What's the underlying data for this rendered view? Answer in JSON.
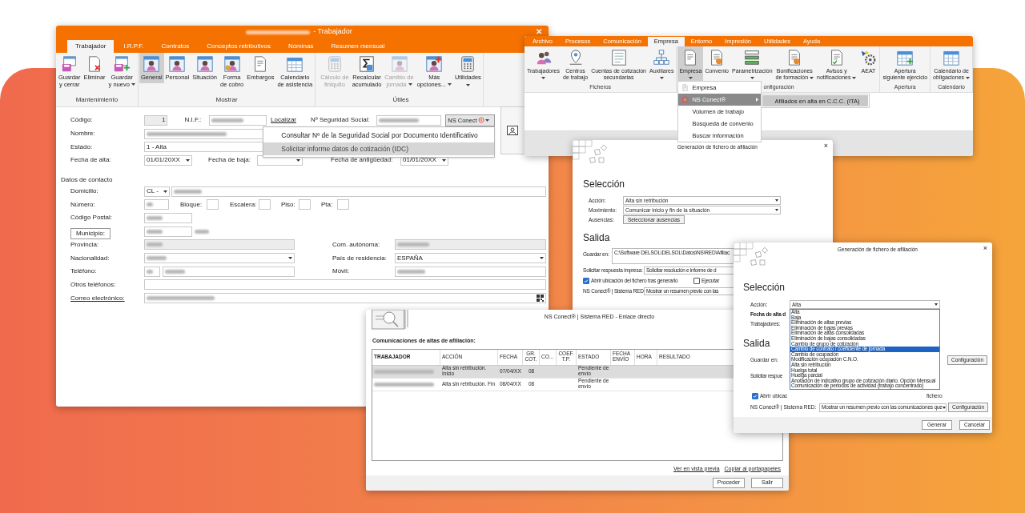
{
  "main_window": {
    "title": "- Trabajador",
    "close": "✕",
    "tabs": [
      {
        "label": "Trabajador",
        "selected": true
      },
      {
        "label": "I.R.P.F.",
        "selected": false
      },
      {
        "label": "Contratos",
        "selected": false
      },
      {
        "label": "Conceptos retributivos",
        "selected": false
      },
      {
        "label": "Nóminas",
        "selected": false
      },
      {
        "label": "Resumen mensual",
        "selected": false
      }
    ],
    "groups": [
      {
        "label": "Mantenimiento",
        "buttons": [
          {
            "lines": [
              "Guardar",
              "y cerrar"
            ],
            "kind": "floppy",
            "menu": false,
            "selected": false,
            "disabled": false
          },
          {
            "lines": [
              "Eliminar"
            ],
            "kind": "delete-doc",
            "menu": false,
            "selected": false,
            "disabled": false
          },
          {
            "lines": [
              "Guardar",
              "y nuevo"
            ],
            "kind": "floppy-plus",
            "menu": true,
            "selected": false,
            "disabled": false
          }
        ]
      },
      {
        "label": "Mostrar",
        "buttons": [
          {
            "lines": [
              "General"
            ],
            "kind": "person",
            "menu": false,
            "selected": true,
            "disabled": false
          },
          {
            "lines": [
              "Personal"
            ],
            "kind": "person",
            "menu": false,
            "selected": false,
            "disabled": false
          },
          {
            "lines": [
              "Situación"
            ],
            "kind": "person",
            "menu": false,
            "selected": false,
            "disabled": false
          },
          {
            "lines": [
              "Forma",
              "de cobro"
            ],
            "kind": "money",
            "menu": false,
            "selected": false,
            "disabled": false
          },
          {
            "lines": [
              "Embargos"
            ],
            "kind": "document",
            "menu": false,
            "selected": false,
            "disabled": false
          },
          {
            "lines": [
              "Calendario",
              "de asistencia"
            ],
            "kind": "calendar",
            "menu": false,
            "selected": false,
            "disabled": false
          }
        ]
      },
      {
        "label": "Útiles",
        "buttons": [
          {
            "lines": [
              "Cálculo de",
              "finiquito"
            ],
            "kind": "calculator",
            "menu": false,
            "selected": false,
            "disabled": true
          },
          {
            "lines": [
              "Recalcular",
              "acumulado"
            ],
            "kind": "sigma",
            "menu": false,
            "selected": false,
            "disabled": false
          },
          {
            "lines": [
              "Cambio de",
              "jornada"
            ],
            "kind": "person",
            "menu": true,
            "selected": false,
            "disabled": true
          },
          {
            "lines": [
              "Más",
              "opciones..."
            ],
            "kind": "person-plus",
            "menu": true,
            "selected": false,
            "disabled": false
          },
          {
            "lines": [
              "Utilidades"
            ],
            "kind": "calculator",
            "menu": true,
            "selected": false,
            "disabled": false
          }
        ]
      }
    ],
    "form": {
      "codigo": {
        "label": "Código:",
        "value": "1"
      },
      "nif": {
        "label": "N.I.F.:"
      },
      "localizar": "Localizar",
      "nss": {
        "label": "Nº Seguridad Social:"
      },
      "ns_conect": {
        "label": "NS Conect",
        "expanded": true
      },
      "ns_menu": [
        {
          "label": "Consultar Nº de la Seguridad Social por Documento Identificativo",
          "selected": false
        },
        {
          "label": "Solicitar informe datos de cotización (IDC)",
          "selected": true
        }
      ],
      "nombre": {
        "label": "Nombre:"
      },
      "estado": {
        "label": "Estado:",
        "value": "1 - Alta"
      },
      "fecha_alta": {
        "label": "Fecha de alta:",
        "value": "01/01/20XX"
      },
      "fecha_baja": {
        "label": "Fecha de baja:"
      },
      "fecha_antiguedad": {
        "label": "Fecha de antigüedad:",
        "value": "01/01/20XX"
      },
      "contact_heading": "Datos de contacto",
      "domicilio": {
        "label": "Domicilio:",
        "via": "CL -"
      },
      "numero": {
        "label": "Número:"
      },
      "bloque": {
        "label": "Bloque:"
      },
      "escalera": {
        "label": "Escalera:"
      },
      "piso": {
        "label": "Piso:"
      },
      "pta": {
        "label": "Pta:"
      },
      "codigo_postal": {
        "label": "Código Postal:"
      },
      "municipio": {
        "label": "Municipio:"
      },
      "provincia": {
        "label": "Provincia:"
      },
      "com_autonoma": {
        "label": "Com. autónoma:"
      },
      "nacionalidad": {
        "label": "Nacionalidad:"
      },
      "pais": {
        "label": "País de residencia:",
        "value": "ESPAÑA"
      },
      "telefono": {
        "label": "Teléfono:"
      },
      "movil": {
        "label": "Móvil:"
      },
      "otros": {
        "label": "Otros teléfonos:"
      },
      "correo": {
        "label": "Correo electrónico:"
      }
    }
  },
  "company_window": {
    "tabs": [
      {
        "label": "Archivo",
        "selected": false
      },
      {
        "label": "Procesos",
        "selected": false
      },
      {
        "label": "Comunicación",
        "selected": false
      },
      {
        "label": "Empresa",
        "selected": true
      },
      {
        "label": "Entorno",
        "selected": false
      },
      {
        "label": "Impresión",
        "selected": false
      },
      {
        "label": "Utilidades",
        "selected": false
      },
      {
        "label": "Ayuda",
        "selected": false
      }
    ],
    "groups": [
      {
        "label": "Ficheros",
        "buttons": [
          {
            "lines": [
              "Trabajadores"
            ],
            "kind": "people",
            "menu": true,
            "selected": false
          },
          {
            "lines": [
              "Centros",
              "de trabajo"
            ],
            "kind": "pin",
            "menu": false,
            "selected": false
          },
          {
            "lines": [
              "Cuentas de cotización",
              "secundarias"
            ],
            "kind": "form",
            "menu": false,
            "selected": false
          },
          {
            "lines": [
              "Auxiliares"
            ],
            "kind": "hierarchy",
            "menu": true,
            "selected": false
          }
        ]
      },
      {
        "label": "onfiguración",
        "buttons": [
          {
            "lines": [
              "Empresa"
            ],
            "kind": "document",
            "menu": true,
            "selected": true
          },
          {
            "lines": [
              "Convenio"
            ],
            "kind": "award",
            "menu": false,
            "selected": false
          },
          {
            "lines": [
              "Parametrización"
            ],
            "kind": "list",
            "menu": true,
            "selected": false
          },
          {
            "lines": [
              "Bonificaciones",
              "de formación"
            ],
            "kind": "award",
            "menu": true,
            "selected": false
          },
          {
            "lines": [
              "Avisos y",
              "notificaciones"
            ],
            "kind": "checklist",
            "menu": true,
            "selected": false
          },
          {
            "lines": [
              "AEAT"
            ],
            "kind": "gear",
            "menu": false,
            "selected": false
          }
        ]
      },
      {
        "label": "Apertura",
        "buttons": [
          {
            "lines": [
              "Apertura",
              "siguiente ejercicio"
            ],
            "kind": "calendar-plus",
            "menu": false,
            "selected": false
          }
        ]
      },
      {
        "label": "Calendario",
        "buttons": [
          {
            "lines": [
              "Calendario de",
              "obligaciones"
            ],
            "kind": "calendar",
            "menu": true,
            "selected": false
          }
        ]
      }
    ],
    "menu": [
      {
        "label": "Empresa",
        "kind": "document",
        "submenu": false,
        "selected": false
      },
      {
        "label": "NS Conect®",
        "kind": "ns-logo",
        "submenu": true,
        "selected": true
      },
      {
        "label": "Volumen de trabajo",
        "submenu": false,
        "selected": false
      },
      {
        "label": "Búsqueda de convenio",
        "submenu": false,
        "selected": false
      },
      {
        "label": "Buscar información",
        "submenu": false,
        "selected": false
      }
    ],
    "submenu": [
      {
        "label": "Afiliados en alta en C.C.C. (ITA)",
        "selected": true
      }
    ]
  },
  "dialog_back": {
    "title": "Generación de fichero de afiliación",
    "close": "×",
    "selection_heading": "Selección",
    "accion": {
      "label": "Acción:",
      "value": "Alta sin retribución"
    },
    "movimiento": {
      "label": "Movimiento:",
      "value": "Comunicar inicio y fin de la situación"
    },
    "ausencias": {
      "label": "Ausencias:",
      "button": "Seleccionar ausencias"
    },
    "output_heading": "Salida",
    "guardar": {
      "label": "Guardar en:",
      "value": "C:\\Software DELSOL\\DELSOL\\Datos\\NS\\RED\\Afiliac"
    },
    "respuesta": {
      "label": "Solicitar respuesta impresa:",
      "value": "Solicitar resolución e informe de d"
    },
    "checks": [
      {
        "label": "Abrir ubicación del fichero tras generarlo",
        "checked": true
      },
      {
        "label": "Ejecutar",
        "checked": false
      }
    ],
    "red": {
      "label": "NS Conect® | Sistema RED:",
      "value": "Mostrar un resumen previo con las"
    }
  },
  "red_window": {
    "title": "NS Conect® | Sistema RED - Enlace directo",
    "heading": "Comunicaciones de altas de afiliación:",
    "columns": [
      "TRABAJADOR",
      "ACCIÓN",
      "FECHA",
      "GR. COT.",
      "CO...",
      "COEF. T.P.",
      "ESTADO",
      "FECHA ENVÍO",
      "HORA",
      "RESULTADO"
    ],
    "rows": [
      {
        "selected": true,
        "cells": [
          "",
          "Alta sin retribución. Inicio",
          "07/04/XX",
          "08",
          "",
          "",
          "Pendiente de envío",
          "",
          "",
          ""
        ]
      },
      {
        "selected": false,
        "cells": [
          "",
          "Alta sin retribución. Fin",
          "08/04/XX",
          "08",
          "",
          "",
          "Pendiente de envío",
          "",
          "",
          ""
        ]
      }
    ],
    "links": [
      "Ver en vista previa",
      "Copiar al portapapeles"
    ],
    "buttons": [
      "Proceder",
      "Salir"
    ]
  },
  "dialog_front": {
    "title": "Generación de fichero de afiliación",
    "close": "×",
    "selection_heading": "Selección",
    "accion": {
      "label": "Acción:",
      "value": "Alta",
      "expanded": true
    },
    "options": [
      {
        "label": "Alta",
        "selected": false
      },
      {
        "label": "Baja",
        "selected": false
      },
      {
        "label": "Eliminación de altas previas",
        "selected": false
      },
      {
        "label": "Eliminación de bajas previas",
        "selected": false
      },
      {
        "label": "Eliminación de altas consolidadas",
        "selected": false
      },
      {
        "label": "Eliminación de bajas consolidadas",
        "selected": false
      },
      {
        "label": "Cambio de grupo de cotización",
        "selected": false
      },
      {
        "label": "Cambio de contrato / coeficiente de jornada",
        "selected": true
      },
      {
        "label": "Cambio de ocupación",
        "selected": false
      },
      {
        "label": "Modificación ocupación C.N.O.",
        "selected": false
      },
      {
        "label": "Alta sin retribución",
        "selected": false
      },
      {
        "label": "Huelga total",
        "selected": false
      },
      {
        "label": "Huelga parcial",
        "selected": false
      },
      {
        "label": "Anotación de indicativo grupo de cotización diario. Opción Mensual",
        "selected": false
      },
      {
        "label": "Comunicación de periodos de actividad (trabajo concentrado)",
        "selected": false
      }
    ],
    "fecha_label": "Fecha de alta d",
    "trabajadores_label": "Trabajadores:",
    "output_heading": "Salida",
    "guardar_label": "Guardar en:",
    "config_buttons": [
      "Configuración",
      "Configuración"
    ],
    "respuesta_label": "Solicitar respue",
    "check": {
      "label": "Abrir ubicac",
      "checked": true
    },
    "check_tail": "fichero",
    "red": {
      "label": "NS Conect® | Sistema RED:",
      "value": "Mostrar un resumen previo con las comunicaciones que"
    },
    "footer_buttons": [
      "Generar",
      "Cancelar"
    ]
  }
}
